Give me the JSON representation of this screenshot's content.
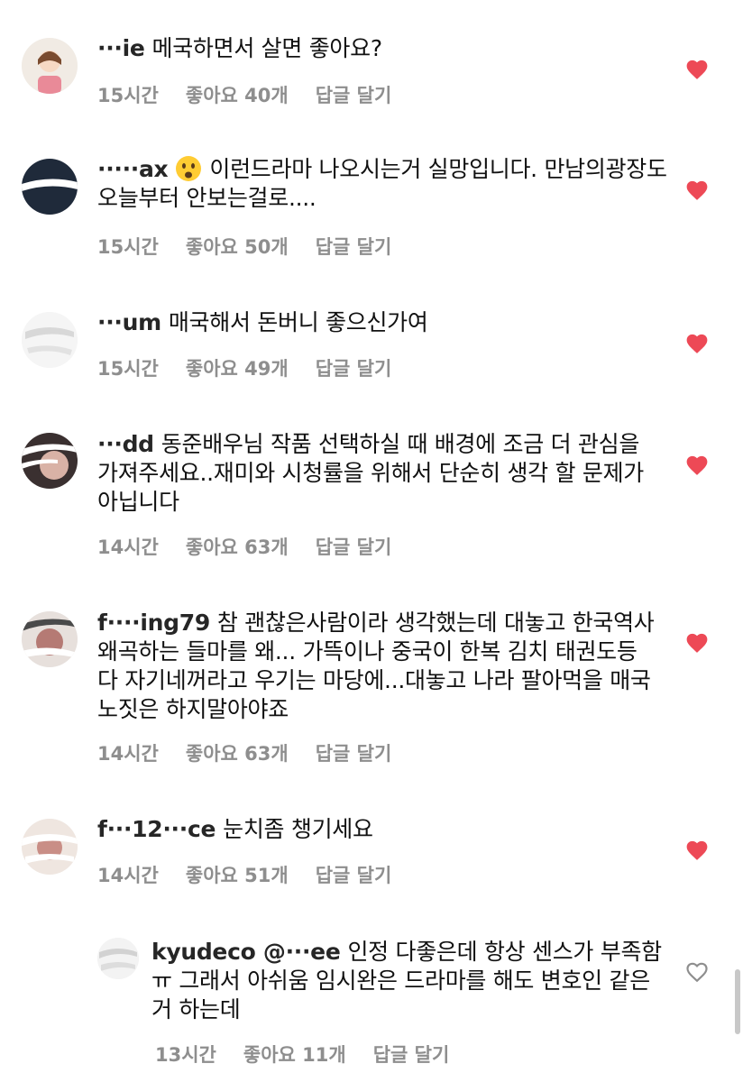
{
  "comments": [
    {
      "username": "···ie",
      "text": "메국하면서 살면 좋아요?",
      "time": "15시간",
      "likes": "좋아요 40개",
      "reply": "답글 달기",
      "liked": true
    },
    {
      "username": "·····ax",
      "text": "이런드라마 나오시는거 실망입니다. 만남의광장도 오늘부터 안보는걸로....",
      "time": "15시간",
      "likes": "좋아요 50개",
      "reply": "답글 달기",
      "liked": true,
      "emoji": "frowning-face-with-open-mouth"
    },
    {
      "username": "···um",
      "text": "매국해서 돈버니 좋으신가여",
      "time": "15시간",
      "likes": "좋아요 49개",
      "reply": "답글 달기",
      "liked": true
    },
    {
      "username": "···dd",
      "text": "동준배우님 작품 선택하실 때 배경에 조금 더 관심을 가져주세요..재미와 시청률을 위해서 단순히 생각 할 문제가 아닙니다",
      "time": "14시간",
      "likes": "좋아요 63개",
      "reply": "답글 달기",
      "liked": true
    },
    {
      "username": "f····ing79",
      "text": "참 괜찮은사람이라 생각했는데 대놓고 한국역사왜곡하는 들마를 왜... 가뜩이나 중국이 한복 김치 태권도등 다 자기네꺼라고 우기는 마당에...대놓고 나라 팔아먹을 매국노짓은 하지말아야죠",
      "time": "14시간",
      "likes": "좋아요 63개",
      "reply": "답글 달기",
      "liked": true
    },
    {
      "username": "f···12···ce",
      "text": "눈치좀 챙기세요",
      "time": "14시간",
      "likes": "좋아요 51개",
      "reply": "답글 달기",
      "liked": true
    },
    {
      "username": "kyudeco @···ee",
      "text": "인정 다좋은데 항상 센스가 부족함 ㅠ 그래서 아쉬움 임시완은 드라마를 해도 변호인 같은거 하는데",
      "time": "13시간",
      "likes": "좋아요 11개",
      "reply": "답글 달기",
      "liked": false
    }
  ],
  "colors": {
    "heart_active": "#ed4956",
    "heart_outline": "#8e8e8e",
    "meta_text": "#8e8e8e"
  }
}
